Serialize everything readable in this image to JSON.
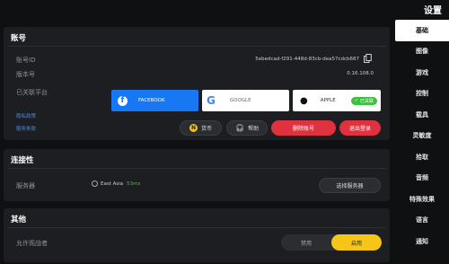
{
  "header": {
    "title": "设置"
  },
  "sidebar": {
    "items": [
      {
        "label": "基础",
        "active": true
      },
      {
        "label": "图像"
      },
      {
        "label": "游戏"
      },
      {
        "label": "控制"
      },
      {
        "label": "载具"
      },
      {
        "label": "灵敏度"
      },
      {
        "label": "拾取"
      },
      {
        "label": "音频"
      },
      {
        "label": "特殊效果"
      },
      {
        "label": "语言"
      },
      {
        "label": "通知"
      }
    ]
  },
  "account": {
    "title": "账号",
    "id_label": "账号ID",
    "id_value": "5ebedcad-f291-448d-83cb-dea57cdcb687",
    "version_label": "版本号",
    "version_value": "0.16.108.0",
    "platform_label": "已关联平台",
    "link_privacy": "隐私政策",
    "link_terms": "服务条款",
    "facebook_label": "FACEBOOK",
    "google_label": "GOOGLE",
    "apple_label": "APPLE",
    "apple_status": "已关联",
    "coin_button": "货币",
    "help_button": "帮助",
    "delete_button": "删除账号",
    "logout_button": "退出登录"
  },
  "connectivity": {
    "title": "连接性",
    "server_label": "服务器",
    "server_name": "East Asia",
    "ping": "53ms",
    "select_button": "选择服务器"
  },
  "other": {
    "title": "其他",
    "friends_label": "允许观战者",
    "toggle_off": "禁用",
    "toggle_on": "启用"
  },
  "colors": {
    "facebook": "#1877f2",
    "danger": "#e0313f",
    "toggle_active": "#f5c518",
    "link": "#4f8ad6",
    "ping": "#3cc13c"
  }
}
